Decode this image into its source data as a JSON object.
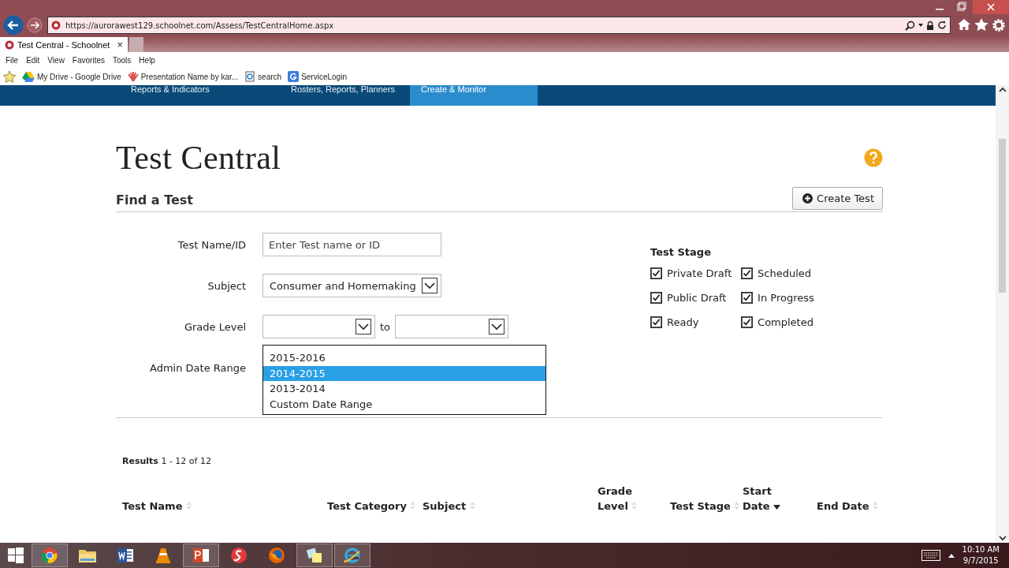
{
  "browser": {
    "url": "https://aurorawest129.schoolnet.com/Assess/TestCentralHome.aspx",
    "tab": {
      "title": "Test Central - Schoolnet",
      "close": "×"
    },
    "menu": [
      "File",
      "Edit",
      "View",
      "Favorites",
      "Tools",
      "Help"
    ],
    "favorites": [
      {
        "kind": "drive",
        "label": "My Drive - Google Drive"
      },
      {
        "kind": "prezi",
        "label": "Presentation Name by kar..."
      },
      {
        "kind": "page",
        "label": "search"
      },
      {
        "kind": "google",
        "label": "ServiceLogin"
      }
    ]
  },
  "nav": [
    {
      "label": "Reports & Indicators",
      "selected": false
    },
    {
      "label": "Rosters, Reports, Planners",
      "selected": false
    },
    {
      "label": "Create & Monitor",
      "selected": true
    }
  ],
  "page": {
    "title": "Test Central",
    "section": "Find a Test",
    "create_button": "Create Test"
  },
  "form": {
    "test_name": {
      "label": "Test Name/ID",
      "placeholder": "Enter Test name or ID"
    },
    "subject": {
      "label": "Subject",
      "value": "Consumer and Homemaking"
    },
    "grade_level": {
      "label": "Grade Level",
      "separator": "to"
    },
    "admin_date_range": {
      "label": "Admin Date Range",
      "expanded": true,
      "options": [
        {
          "label": "2015-2016",
          "selected": false
        },
        {
          "label": "2014-2015",
          "selected": true
        },
        {
          "label": "2013-2014",
          "selected": false
        },
        {
          "label": "Custom Date Range",
          "selected": false
        }
      ]
    }
  },
  "test_stage": {
    "title": "Test Stage",
    "options": [
      {
        "label": "Private Draft",
        "checked": true
      },
      {
        "label": "Scheduled",
        "checked": true
      },
      {
        "label": "Public Draft",
        "checked": true
      },
      {
        "label": "In Progress",
        "checked": true
      },
      {
        "label": "Ready",
        "checked": true
      },
      {
        "label": "Completed",
        "checked": true
      }
    ]
  },
  "results": "**Results** 1 - 12 of 12",
  "table": {
    "columns": [
      {
        "label": "Test Name",
        "sorted": false
      },
      {
        "label": "Test Category",
        "sorted": false
      },
      {
        "label": "Subject",
        "sorted": false
      },
      {
        "label": "Grade Level",
        "sorted": false
      },
      {
        "label": "Test Stage",
        "sorted": false
      },
      {
        "label": "Start Date",
        "sorted": true
      },
      {
        "label": "End Date",
        "sorted": false
      }
    ]
  },
  "taskbar": {
    "apps": [
      {
        "kind": "chrome",
        "running": true
      },
      {
        "kind": "folder",
        "running": false
      },
      {
        "kind": "word",
        "running": false
      },
      {
        "kind": "cone",
        "running": false
      },
      {
        "kind": "powerpoint",
        "running": true
      },
      {
        "kind": "swirl",
        "running": false
      },
      {
        "kind": "firefox",
        "running": false
      },
      {
        "kind": "notes",
        "running": true
      },
      {
        "kind": "ie",
        "running": true
      }
    ],
    "time": "10:10 AM",
    "date": "9/7/2015"
  }
}
